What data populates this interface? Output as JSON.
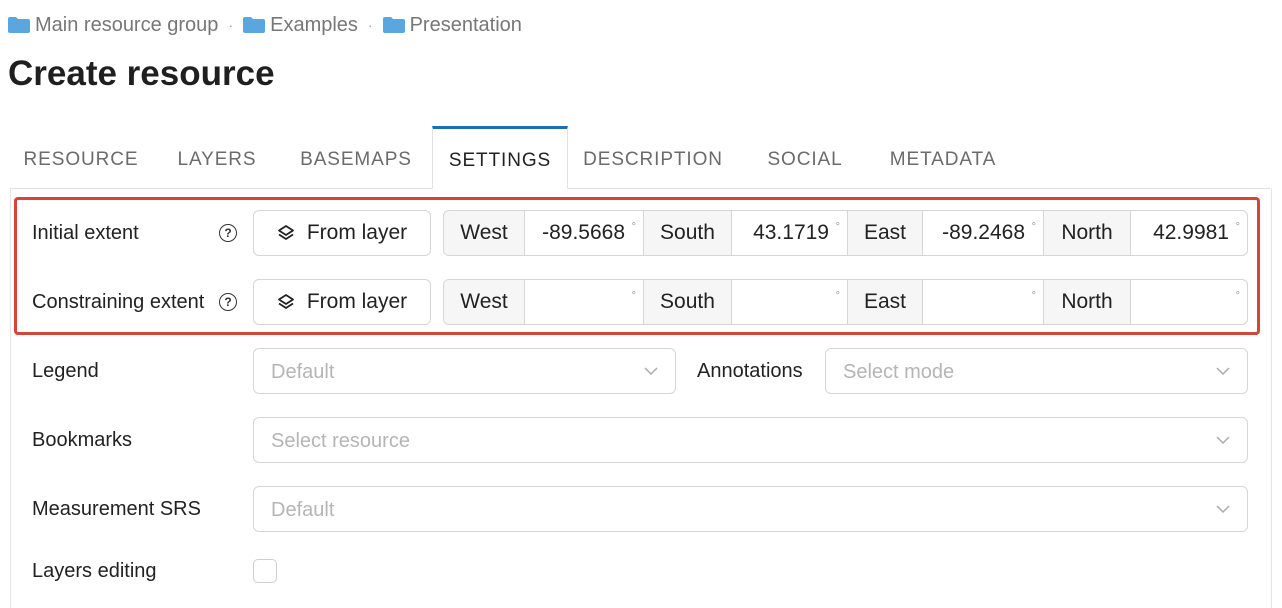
{
  "breadcrumb": {
    "items": [
      {
        "label": "Main resource group",
        "icon": "folder-icon"
      },
      {
        "label": "Examples",
        "icon": "folder-icon"
      },
      {
        "label": "Presentation",
        "icon": "folder-icon"
      }
    ],
    "separator": "·"
  },
  "page_title": "Create resource",
  "tabs": [
    {
      "label": "RESOURCE",
      "active": false
    },
    {
      "label": "LAYERS",
      "active": false
    },
    {
      "label": "BASEMAPS",
      "active": false
    },
    {
      "label": "SETTINGS",
      "active": true
    },
    {
      "label": "DESCRIPTION",
      "active": false
    },
    {
      "label": "SOCIAL",
      "active": false
    },
    {
      "label": "METADATA",
      "active": false
    }
  ],
  "settings": {
    "initial_extent": {
      "label": "Initial extent",
      "help": "?",
      "button": "From layer",
      "west_label": "West",
      "west_value": "-89.5668",
      "south_label": "South",
      "south_value": "43.1719",
      "east_label": "East",
      "east_value": "-89.2468",
      "north_label": "North",
      "north_value": "42.9981",
      "unit": "°"
    },
    "constraining_extent": {
      "label": "Constraining extent",
      "help": "?",
      "button": "From layer",
      "west_label": "West",
      "west_value": "",
      "south_label": "South",
      "south_value": "",
      "east_label": "East",
      "east_value": "",
      "north_label": "North",
      "north_value": "",
      "unit": "°"
    },
    "legend": {
      "label": "Legend",
      "placeholder": "Default"
    },
    "annotations": {
      "label": "Annotations",
      "placeholder": "Select mode"
    },
    "bookmarks": {
      "label": "Bookmarks",
      "placeholder": "Select resource"
    },
    "measurement_srs": {
      "label": "Measurement SRS",
      "placeholder": "Default"
    },
    "layers_editing": {
      "label": "Layers editing",
      "checked": false
    }
  },
  "colors": {
    "accent": "#1a6fb6",
    "folder": "#5aa7e0",
    "highlight": "#d4463a"
  }
}
